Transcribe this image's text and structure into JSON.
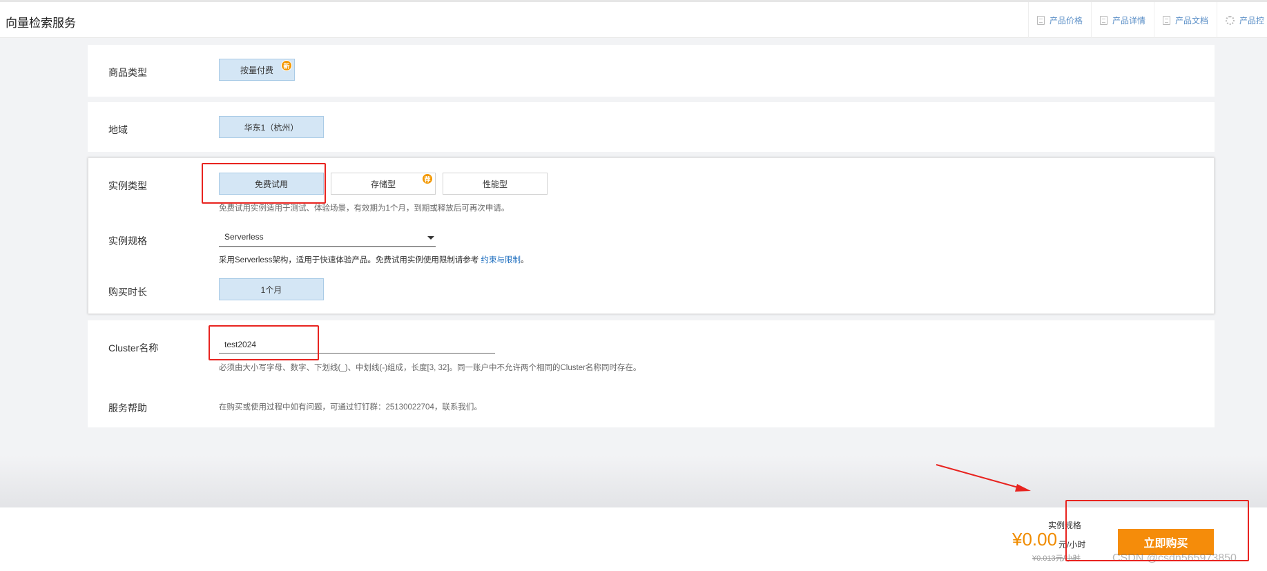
{
  "header": {
    "title": "向量检索服务",
    "links": [
      {
        "label": "产品价格",
        "icon": "doc-icon"
      },
      {
        "label": "产品详情",
        "icon": "doc-icon"
      },
      {
        "label": "产品文档",
        "icon": "doc-icon"
      },
      {
        "label": "产品控",
        "icon": "gear-icon"
      }
    ]
  },
  "product_type": {
    "label": "商品类型",
    "option": "按量付费",
    "badge": "新"
  },
  "region": {
    "label": "地域",
    "option": "华东1（杭州）"
  },
  "instance_type": {
    "label": "实例类型",
    "options": [
      "免费试用",
      "存储型",
      "性能型"
    ],
    "selected": "免费试用",
    "badge": "荐",
    "hint": "免费试用实例适用于测试、体验场景，有效期为1个月，到期或释放后可再次申请。"
  },
  "instance_spec": {
    "label": "实例规格",
    "value": "Serverless",
    "hint_prefix": "采用Serverless架构，适用于快速体验产品。免费试用实例使用限制请参考 ",
    "hint_link": "约束与限制",
    "hint_suffix": "。"
  },
  "duration": {
    "label": "购买时长",
    "option": "1个月"
  },
  "cluster": {
    "label": "Cluster名称",
    "value": "test2024",
    "hint": "必须由大小写字母、数字、下划线(_)、中划线(-)组成，长度[3, 32]。同一账户中不允许两个相同的Cluster名称同时存在。"
  },
  "help": {
    "label": "服务帮助",
    "text": "在购买或使用过程中如有问题，可通过钉钉群：25130022704，联系我们。"
  },
  "footer": {
    "spec_label": "实例规格",
    "price": "¥0.00",
    "unit": "元/小时",
    "original_price": "¥0.013元/小时",
    "buy_label": "立即购买",
    "watermark": "CSDN @csdn565973850"
  },
  "colors": {
    "accent": "#f58c0a",
    "selected_bg": "#d4e6f5",
    "annotation": "#e8231f",
    "link": "#1f6fbf"
  }
}
